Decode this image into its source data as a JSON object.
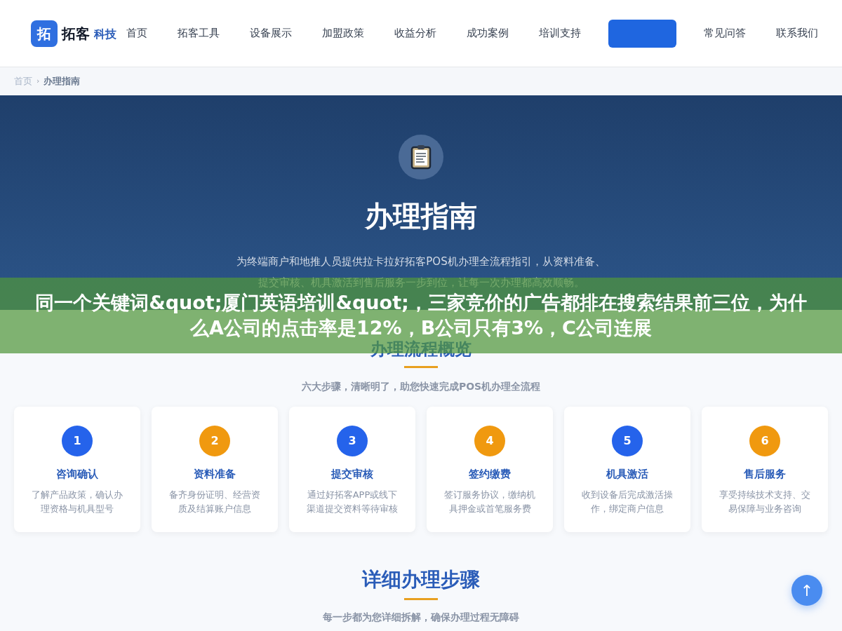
{
  "header": {
    "logo": {
      "mark": "拓",
      "name": "拓客",
      "suffix": "科技"
    },
    "nav": [
      {
        "label": "首页",
        "selected": false
      },
      {
        "label": "拓客工具",
        "selected": false
      },
      {
        "label": "设备展示",
        "selected": false
      },
      {
        "label": "加盟政策",
        "selected": false
      },
      {
        "label": "收益分析",
        "selected": false
      },
      {
        "label": "成功案例",
        "selected": false
      },
      {
        "label": "培训支持",
        "selected": false
      },
      {
        "selected": true
      },
      {
        "label": "常见问答",
        "selected": false
      },
      {
        "label": "联系我们",
        "selected": false
      }
    ]
  },
  "breadcrumb": {
    "separator": "›",
    "items": [
      "首页",
      "办理指南"
    ]
  },
  "hero": {
    "title": "办理指南",
    "subtitle": [
      "为终端商户和地推人员提供拉卡拉好拓客POS机办理全流程指引，从资料准备、",
      "提交审核、机具激活到售后服务一步到位，让每一次办理都高效顺畅。"
    ]
  },
  "overview": {
    "title": "办理流程概览",
    "subtitle": "六大步骤，清晰明了，助您快速完成POS机办理全流程",
    "steps": [
      {
        "number": "1",
        "color": "#2563eb",
        "title": "咨询确认",
        "text": "了解产品政策，确认办理资格与机具型号"
      },
      {
        "number": "2",
        "color": "#f0990f",
        "title": "资料准备",
        "text": "备齐身份证明、经营资质及结算账户信息"
      },
      {
        "number": "3",
        "color": "#2563eb",
        "title": "提交审核",
        "text": "通过好拓客APP或线下渠道提交资料等待审核"
      },
      {
        "number": "4",
        "color": "#f0990f",
        "title": "签约缴费",
        "text": "签订服务协议，缴纳机具押金或首笔服务费"
      },
      {
        "number": "5",
        "color": "#2563eb",
        "title": "机具激活",
        "text": "收到设备后完成激活操作，绑定商户信息"
      },
      {
        "number": "6",
        "color": "#f0990f",
        "title": "售后服务",
        "text": "享受持续技术支持、交易保障与业务咨询"
      }
    ]
  },
  "details": {
    "title": "详细办理步骤",
    "subtitle": "每一步都为您详细拆解，确保办理过程无障碍"
  },
  "back_to_top": "↑",
  "overlay_banner": "同一个关键词&quot;厦门英语培训&quot;，三家竞价的广告都排在搜索结果前三位，为什么A公司的点击率是12%，B公司只有3%，C公司连展"
}
